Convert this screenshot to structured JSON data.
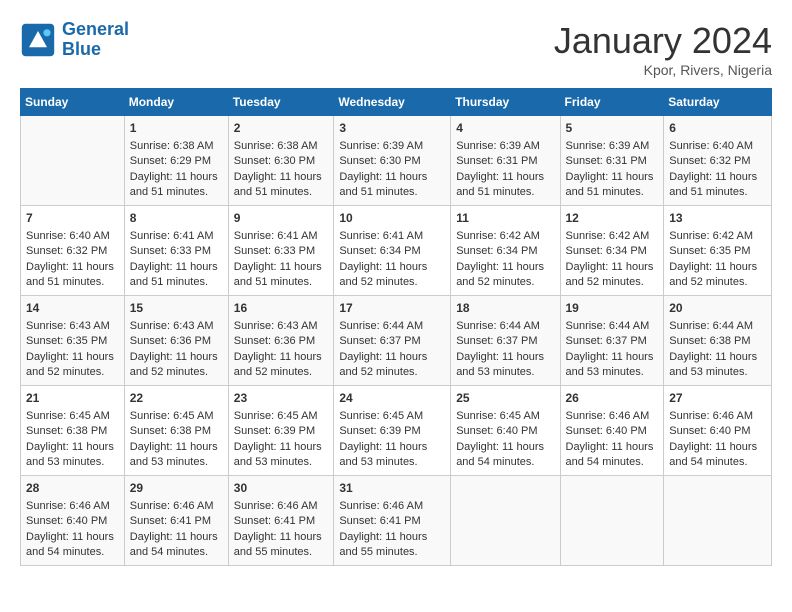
{
  "header": {
    "logo_line1": "General",
    "logo_line2": "Blue",
    "month_title": "January 2024",
    "location": "Kpor, Rivers, Nigeria"
  },
  "days_of_week": [
    "Sunday",
    "Monday",
    "Tuesday",
    "Wednesday",
    "Thursday",
    "Friday",
    "Saturday"
  ],
  "weeks": [
    [
      {
        "day": "",
        "sunrise": "",
        "sunset": "",
        "daylight": ""
      },
      {
        "day": "1",
        "sunrise": "Sunrise: 6:38 AM",
        "sunset": "Sunset: 6:29 PM",
        "daylight": "Daylight: 11 hours and 51 minutes."
      },
      {
        "day": "2",
        "sunrise": "Sunrise: 6:38 AM",
        "sunset": "Sunset: 6:30 PM",
        "daylight": "Daylight: 11 hours and 51 minutes."
      },
      {
        "day": "3",
        "sunrise": "Sunrise: 6:39 AM",
        "sunset": "Sunset: 6:30 PM",
        "daylight": "Daylight: 11 hours and 51 minutes."
      },
      {
        "day": "4",
        "sunrise": "Sunrise: 6:39 AM",
        "sunset": "Sunset: 6:31 PM",
        "daylight": "Daylight: 11 hours and 51 minutes."
      },
      {
        "day": "5",
        "sunrise": "Sunrise: 6:39 AM",
        "sunset": "Sunset: 6:31 PM",
        "daylight": "Daylight: 11 hours and 51 minutes."
      },
      {
        "day": "6",
        "sunrise": "Sunrise: 6:40 AM",
        "sunset": "Sunset: 6:32 PM",
        "daylight": "Daylight: 11 hours and 51 minutes."
      }
    ],
    [
      {
        "day": "7",
        "sunrise": "Sunrise: 6:40 AM",
        "sunset": "Sunset: 6:32 PM",
        "daylight": "Daylight: 11 hours and 51 minutes."
      },
      {
        "day": "8",
        "sunrise": "Sunrise: 6:41 AM",
        "sunset": "Sunset: 6:33 PM",
        "daylight": "Daylight: 11 hours and 51 minutes."
      },
      {
        "day": "9",
        "sunrise": "Sunrise: 6:41 AM",
        "sunset": "Sunset: 6:33 PM",
        "daylight": "Daylight: 11 hours and 51 minutes."
      },
      {
        "day": "10",
        "sunrise": "Sunrise: 6:41 AM",
        "sunset": "Sunset: 6:34 PM",
        "daylight": "Daylight: 11 hours and 52 minutes."
      },
      {
        "day": "11",
        "sunrise": "Sunrise: 6:42 AM",
        "sunset": "Sunset: 6:34 PM",
        "daylight": "Daylight: 11 hours and 52 minutes."
      },
      {
        "day": "12",
        "sunrise": "Sunrise: 6:42 AM",
        "sunset": "Sunset: 6:34 PM",
        "daylight": "Daylight: 11 hours and 52 minutes."
      },
      {
        "day": "13",
        "sunrise": "Sunrise: 6:42 AM",
        "sunset": "Sunset: 6:35 PM",
        "daylight": "Daylight: 11 hours and 52 minutes."
      }
    ],
    [
      {
        "day": "14",
        "sunrise": "Sunrise: 6:43 AM",
        "sunset": "Sunset: 6:35 PM",
        "daylight": "Daylight: 11 hours and 52 minutes."
      },
      {
        "day": "15",
        "sunrise": "Sunrise: 6:43 AM",
        "sunset": "Sunset: 6:36 PM",
        "daylight": "Daylight: 11 hours and 52 minutes."
      },
      {
        "day": "16",
        "sunrise": "Sunrise: 6:43 AM",
        "sunset": "Sunset: 6:36 PM",
        "daylight": "Daylight: 11 hours and 52 minutes."
      },
      {
        "day": "17",
        "sunrise": "Sunrise: 6:44 AM",
        "sunset": "Sunset: 6:37 PM",
        "daylight": "Daylight: 11 hours and 52 minutes."
      },
      {
        "day": "18",
        "sunrise": "Sunrise: 6:44 AM",
        "sunset": "Sunset: 6:37 PM",
        "daylight": "Daylight: 11 hours and 53 minutes."
      },
      {
        "day": "19",
        "sunrise": "Sunrise: 6:44 AM",
        "sunset": "Sunset: 6:37 PM",
        "daylight": "Daylight: 11 hours and 53 minutes."
      },
      {
        "day": "20",
        "sunrise": "Sunrise: 6:44 AM",
        "sunset": "Sunset: 6:38 PM",
        "daylight": "Daylight: 11 hours and 53 minutes."
      }
    ],
    [
      {
        "day": "21",
        "sunrise": "Sunrise: 6:45 AM",
        "sunset": "Sunset: 6:38 PM",
        "daylight": "Daylight: 11 hours and 53 minutes."
      },
      {
        "day": "22",
        "sunrise": "Sunrise: 6:45 AM",
        "sunset": "Sunset: 6:38 PM",
        "daylight": "Daylight: 11 hours and 53 minutes."
      },
      {
        "day": "23",
        "sunrise": "Sunrise: 6:45 AM",
        "sunset": "Sunset: 6:39 PM",
        "daylight": "Daylight: 11 hours and 53 minutes."
      },
      {
        "day": "24",
        "sunrise": "Sunrise: 6:45 AM",
        "sunset": "Sunset: 6:39 PM",
        "daylight": "Daylight: 11 hours and 53 minutes."
      },
      {
        "day": "25",
        "sunrise": "Sunrise: 6:45 AM",
        "sunset": "Sunset: 6:40 PM",
        "daylight": "Daylight: 11 hours and 54 minutes."
      },
      {
        "day": "26",
        "sunrise": "Sunrise: 6:46 AM",
        "sunset": "Sunset: 6:40 PM",
        "daylight": "Daylight: 11 hours and 54 minutes."
      },
      {
        "day": "27",
        "sunrise": "Sunrise: 6:46 AM",
        "sunset": "Sunset: 6:40 PM",
        "daylight": "Daylight: 11 hours and 54 minutes."
      }
    ],
    [
      {
        "day": "28",
        "sunrise": "Sunrise: 6:46 AM",
        "sunset": "Sunset: 6:40 PM",
        "daylight": "Daylight: 11 hours and 54 minutes."
      },
      {
        "day": "29",
        "sunrise": "Sunrise: 6:46 AM",
        "sunset": "Sunset: 6:41 PM",
        "daylight": "Daylight: 11 hours and 54 minutes."
      },
      {
        "day": "30",
        "sunrise": "Sunrise: 6:46 AM",
        "sunset": "Sunset: 6:41 PM",
        "daylight": "Daylight: 11 hours and 55 minutes."
      },
      {
        "day": "31",
        "sunrise": "Sunrise: 6:46 AM",
        "sunset": "Sunset: 6:41 PM",
        "daylight": "Daylight: 11 hours and 55 minutes."
      },
      {
        "day": "",
        "sunrise": "",
        "sunset": "",
        "daylight": ""
      },
      {
        "day": "",
        "sunrise": "",
        "sunset": "",
        "daylight": ""
      },
      {
        "day": "",
        "sunrise": "",
        "sunset": "",
        "daylight": ""
      }
    ]
  ]
}
